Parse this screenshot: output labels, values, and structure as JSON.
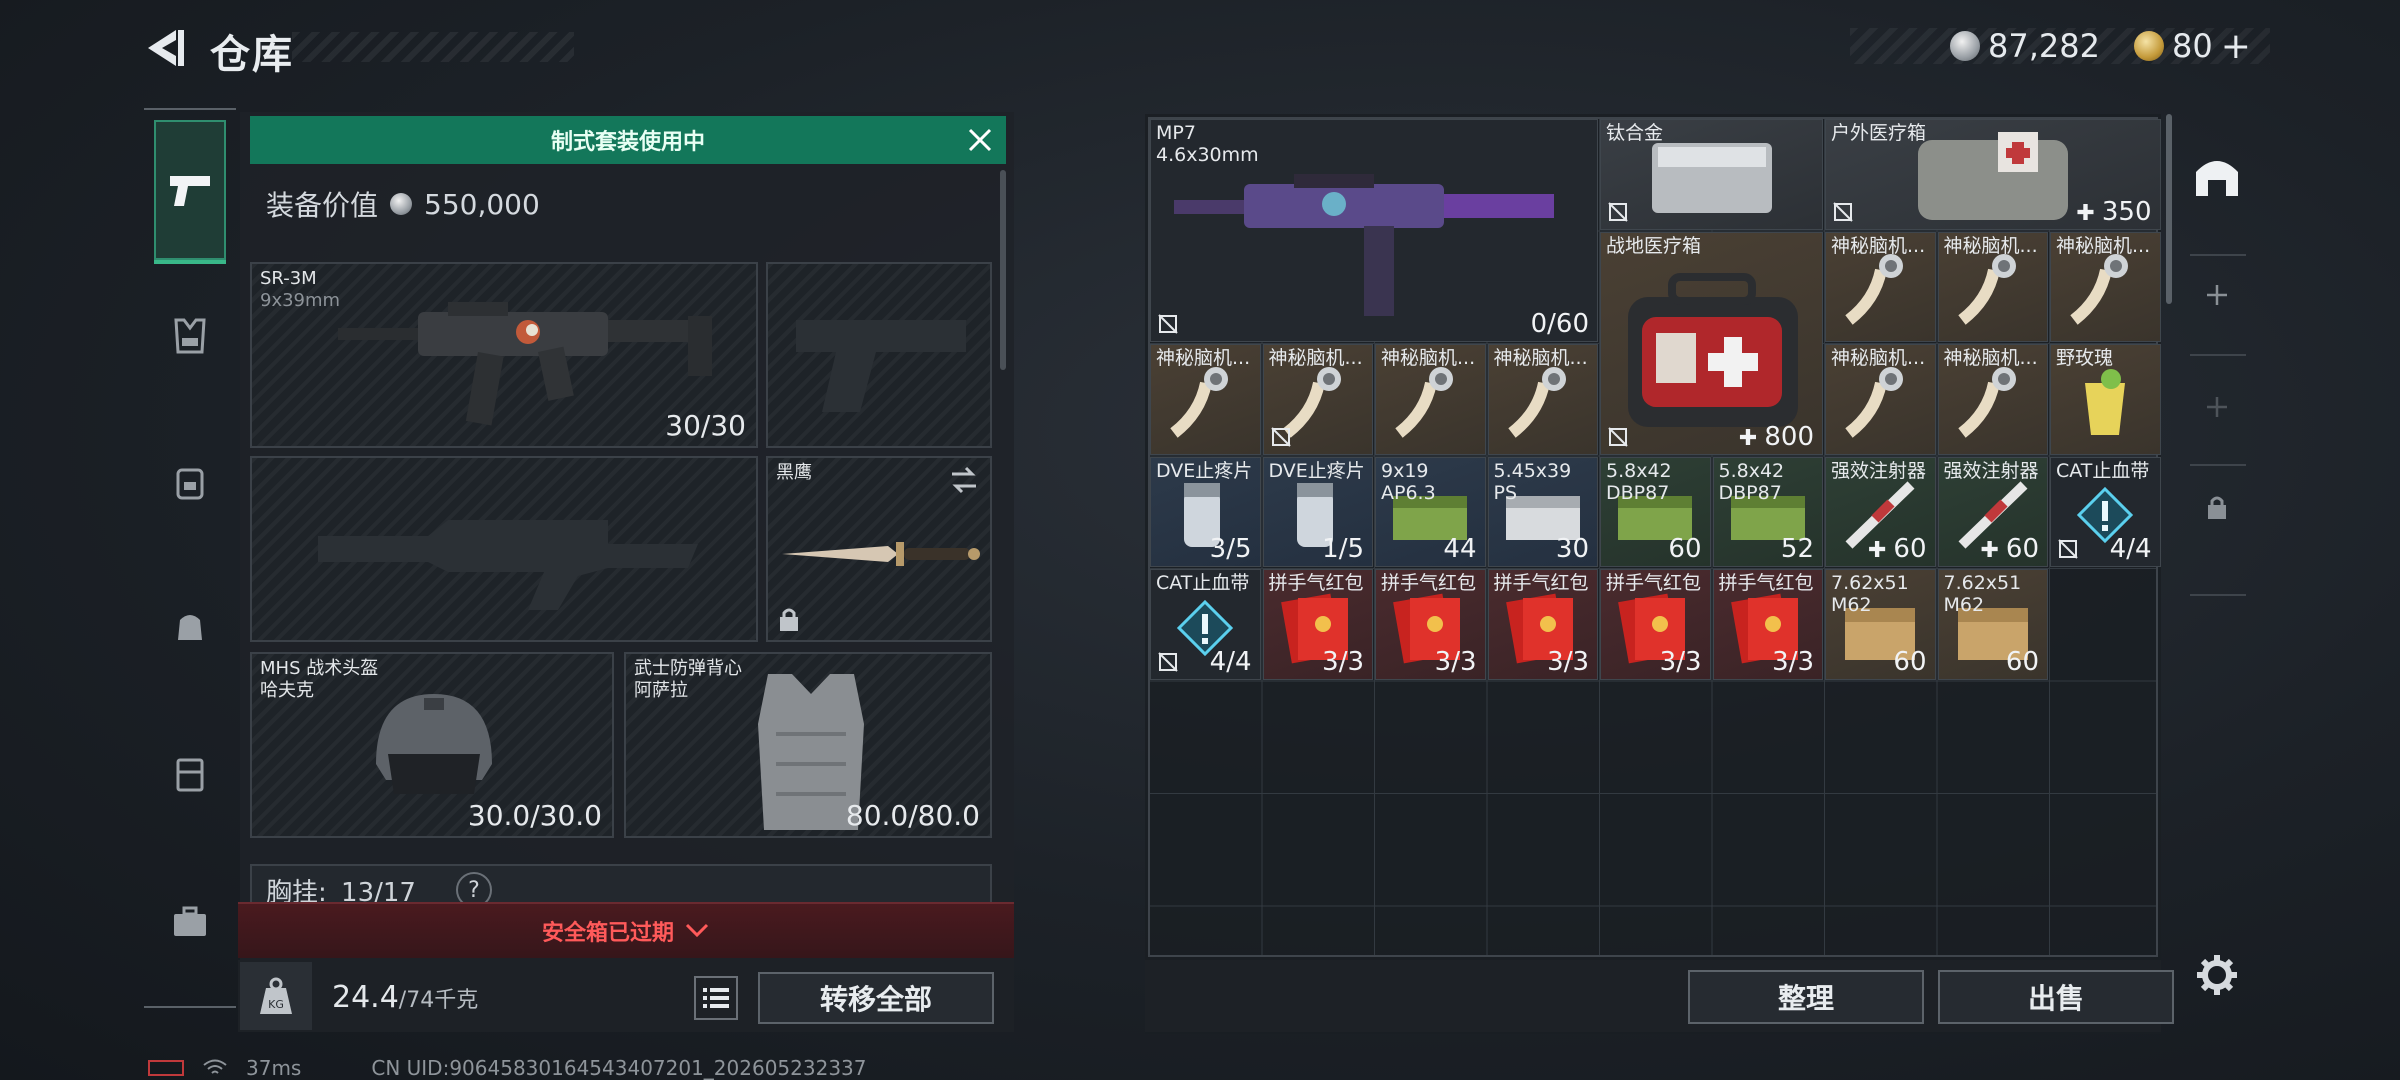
{
  "header": {
    "title": "仓库",
    "currency_silver": "87,282",
    "currency_gold": "80",
    "currency_gold_plus": "+"
  },
  "loadout": {
    "banner": "制式套装使用中",
    "value_label": "装备价值",
    "value": "550,000",
    "primary": {
      "name": "SR-3M",
      "caliber": "9x39mm",
      "ammo": "30/30"
    },
    "melee": {
      "name": "黑鹰"
    },
    "helmet": {
      "name": "MHS 战术头盔",
      "sub": "哈夫克",
      "durability": "30.0/30.0"
    },
    "armor": {
      "name": "武士防弹背心",
      "sub": "阿萨拉",
      "durability": "80.0/80.0"
    },
    "chest_label": "胸挂:",
    "chest_value": "13/17",
    "help": "?",
    "safe_box_text": "安全箱已过期",
    "weight": "24.4",
    "weight_max": "/74千克",
    "kg_label": "KG",
    "transfer_all": "转移全部"
  },
  "inventory": {
    "items": [
      {
        "name": "MP7",
        "sub": "4.6x30mm",
        "qty": "0/60"
      },
      {
        "name": "钛合金",
        "qty": ""
      },
      {
        "name": "户外医疗箱",
        "qty": "350"
      },
      {
        "name": "战地医疗箱",
        "qty": "800"
      },
      {
        "name": "神秘脑机...",
        "qty": ""
      },
      {
        "name": "神秘脑机...",
        "qty": ""
      },
      {
        "name": "神秘脑机...",
        "qty": ""
      },
      {
        "name": "神秘脑机...",
        "qty": ""
      },
      {
        "name": "神秘脑机...",
        "qty": ""
      },
      {
        "name": "神秘脑机...",
        "qty": ""
      },
      {
        "name": "神秘脑机...",
        "qty": ""
      },
      {
        "name": "神秘脑机...",
        "qty": ""
      },
      {
        "name": "神秘脑机...",
        "qty": ""
      },
      {
        "name": "野玫瑰",
        "qty": ""
      },
      {
        "name": "DVE止疼片",
        "qty": "3/5"
      },
      {
        "name": "DVE止疼片",
        "qty": "1/5"
      },
      {
        "name": "9x19",
        "sub": "AP6.3",
        "qty": "44"
      },
      {
        "name": "5.45x39",
        "sub": "PS",
        "qty": "30"
      },
      {
        "name": "5.8x42",
        "sub": "DBP87",
        "qty": "60"
      },
      {
        "name": "5.8x42",
        "sub": "DBP87",
        "qty": "52"
      },
      {
        "name": "强效注射器",
        "qty": "60"
      },
      {
        "name": "强效注射器",
        "qty": "60"
      },
      {
        "name": "CAT止血带",
        "qty": "4/4"
      },
      {
        "name": "CAT止血带",
        "qty": "4/4"
      },
      {
        "name": "拼手气红包",
        "qty": "3/3"
      },
      {
        "name": "拼手气红包",
        "qty": "3/3"
      },
      {
        "name": "拼手气红包",
        "qty": "3/3"
      },
      {
        "name": "拼手气红包",
        "qty": "3/3"
      },
      {
        "name": "拼手气红包",
        "qty": "3/3"
      },
      {
        "name": "7.62x51",
        "sub": "M62",
        "qty": "60"
      },
      {
        "name": "7.62x51",
        "sub": "M62",
        "qty": "60"
      }
    ],
    "sort_label": "整理",
    "sell_label": "出售"
  },
  "footer": {
    "ping": "37ms",
    "uid": "CN UID:90645830164543407201_202605232337"
  },
  "colors": {
    "accent_green": "#13775a",
    "warning_red": "#ff5a5a"
  }
}
